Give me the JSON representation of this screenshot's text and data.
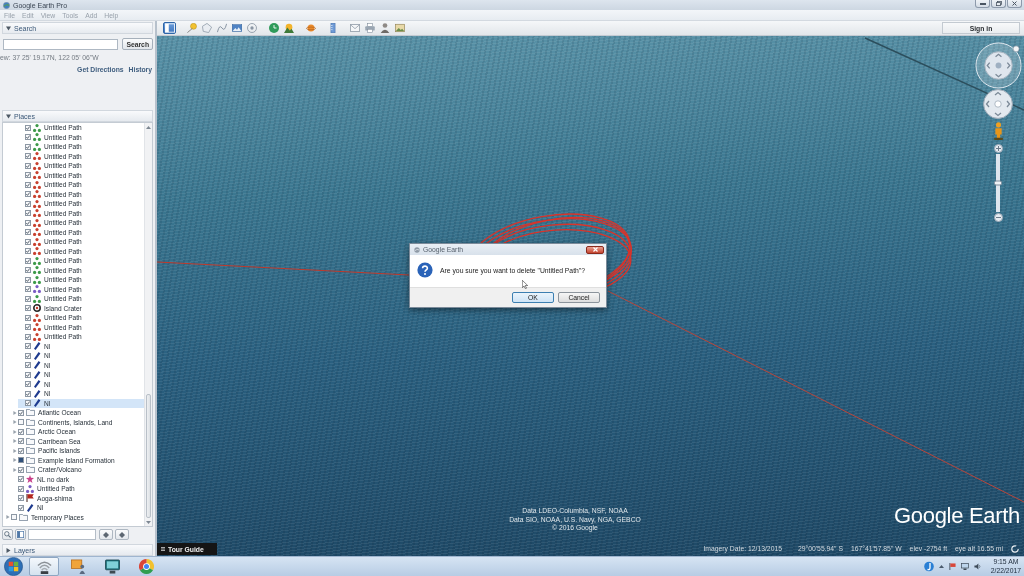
{
  "window": {
    "title": "Google Earth Pro"
  },
  "menu": [
    "File",
    "Edit",
    "View",
    "Tools",
    "Add",
    "Help"
  ],
  "search": {
    "header": "Search",
    "expanded": true,
    "button": "Search",
    "location": "ew: 37 25' 19.17N, 122 05' 06\"W",
    "links": [
      "Get Directions",
      "History"
    ]
  },
  "places": {
    "header": "Places",
    "expanded": true,
    "tree": [
      {
        "children": [
          {
            "children": [
              {
                "label": "Untitled Path",
                "kind": "path",
                "color": "#3c9a48",
                "checked": true,
                "selected": false
              },
              {
                "label": "Untitled Path",
                "kind": "path",
                "color": "#3c9a48",
                "checked": true,
                "selected": false
              },
              {
                "label": "Untitled Path",
                "kind": "path",
                "color": "#3c9a48",
                "checked": true,
                "selected": false
              },
              {
                "label": "Untitled Path",
                "kind": "path",
                "color": "#c8402e",
                "checked": true,
                "selected": false
              },
              {
                "label": "Untitled Path",
                "kind": "path",
                "color": "#c8402e",
                "checked": true,
                "selected": false
              },
              {
                "label": "Untitled Path",
                "kind": "path",
                "color": "#c8402e",
                "checked": true,
                "selected": false
              },
              {
                "label": "Untitled Path",
                "kind": "path",
                "color": "#c8402e",
                "checked": true,
                "selected": false
              },
              {
                "label": "Untitled Path",
                "kind": "path",
                "color": "#c8402e",
                "checked": true,
                "selected": false
              },
              {
                "label": "Untitled Path",
                "kind": "path",
                "color": "#c8402e",
                "checked": true,
                "selected": false
              },
              {
                "label": "Untitled Path",
                "kind": "path",
                "color": "#c8402e",
                "checked": true,
                "selected": false
              },
              {
                "label": "Untitled Path",
                "kind": "path",
                "color": "#c8402e",
                "checked": true,
                "selected": false
              },
              {
                "label": "Untitled Path",
                "kind": "path",
                "color": "#c8402e",
                "checked": true,
                "selected": false
              },
              {
                "label": "Untitled Path",
                "kind": "path",
                "color": "#c8402e",
                "checked": true,
                "selected": false
              },
              {
                "label": "Untitled Path",
                "kind": "path",
                "color": "#c8402e",
                "checked": true,
                "selected": false
              },
              {
                "label": "Untitled Path",
                "kind": "path",
                "color": "#3c9a48",
                "checked": true,
                "selected": false
              },
              {
                "label": "Untitled Path",
                "kind": "path",
                "color": "#3c9a48",
                "checked": true,
                "selected": false
              },
              {
                "label": "Untitled Path",
                "kind": "path",
                "color": "#3c9a48",
                "checked": true,
                "selected": false
              },
              {
                "label": "Untitled Path",
                "kind": "path",
                "color": "#7a5cc4",
                "checked": true,
                "selected": false
              },
              {
                "label": "Untitled Path",
                "kind": "path",
                "color": "#3c9a48",
                "checked": true,
                "selected": false
              },
              {
                "label": "Island Crater",
                "kind": "crater",
                "checked": true,
                "selected": false
              },
              {
                "label": "Untitled Path",
                "kind": "path",
                "color": "#c8402e",
                "checked": true,
                "selected": false
              },
              {
                "label": "Untitled Path",
                "kind": "path",
                "color": "#c8402e",
                "checked": true,
                "selected": false
              },
              {
                "label": "Untitled Path",
                "kind": "path",
                "color": "#c8402e",
                "checked": true,
                "selected": false
              },
              {
                "label": "Nl",
                "kind": "pin",
                "checked": true,
                "selected": false
              },
              {
                "label": "Nl",
                "kind": "pin",
                "checked": true,
                "selected": false
              },
              {
                "label": "Nl",
                "kind": "pin",
                "checked": true,
                "selected": false
              },
              {
                "label": "Nl",
                "kind": "pin",
                "checked": true,
                "selected": false
              },
              {
                "label": "Nl",
                "kind": "pin",
                "checked": true,
                "selected": false
              },
              {
                "label": "Nl",
                "kind": "pin",
                "checked": true,
                "selected": false
              },
              {
                "label": "Nl",
                "kind": "pin",
                "checked": true,
                "selected": true
              }
            ]
          },
          {
            "label": "Atlantic Ocean",
            "kind": "folder",
            "checked": true,
            "partial": false,
            "expanded": false,
            "selected": false
          },
          {
            "label": "Continents, Islands, Land",
            "kind": "folder",
            "checked": false,
            "partial": false,
            "expanded": false,
            "selected": false
          },
          {
            "label": "Arctic Ocean",
            "kind": "folder",
            "checked": true,
            "partial": false,
            "expanded": false,
            "selected": false
          },
          {
            "label": "Carribean Sea",
            "kind": "folder",
            "checked": true,
            "partial": false,
            "expanded": false,
            "selected": false
          },
          {
            "label": "Pacific Islands",
            "kind": "folder",
            "checked": true,
            "partial": false,
            "expanded": false,
            "selected": false
          },
          {
            "label": "Example Island Formation",
            "kind": "folder",
            "checked": true,
            "partial": true,
            "expanded": false,
            "selected": false
          },
          {
            "label": "Crater/Volcano",
            "kind": "folder",
            "checked": true,
            "partial": false,
            "expanded": false,
            "selected": false
          },
          {
            "label": "NL no dark",
            "kind": "star",
            "checked": true,
            "selected": false
          },
          {
            "label": "Untitled Path",
            "kind": "path",
            "color": "#7a5cc4",
            "checked": true,
            "selected": false
          },
          {
            "label": "Aoga-shima",
            "kind": "flag",
            "checked": true,
            "selected": false
          },
          {
            "label": "Nl",
            "kind": "pin",
            "checked": true,
            "selected": false
          }
        ]
      },
      {
        "label": "Temporary Places",
        "kind": "folder",
        "checked": false,
        "partial": false,
        "expanded": false,
        "selected": false
      }
    ]
  },
  "layers": {
    "header": "Layers",
    "expanded": false
  },
  "toolbar": {
    "groups": [
      [
        {
          "kind": "sidebar",
          "selected": true
        }
      ],
      [
        {
          "kind": "placemark",
          "selected": false
        },
        {
          "kind": "polygon",
          "selected": false
        },
        {
          "kind": "path",
          "selected": false
        },
        {
          "kind": "overlay",
          "selected": false
        },
        {
          "kind": "tour",
          "selected": false
        }
      ],
      [
        {
          "kind": "history",
          "selected": false
        },
        {
          "kind": "sun",
          "selected": false
        }
      ],
      [
        {
          "kind": "planets",
          "selected": false
        }
      ],
      [
        {
          "kind": "ruler",
          "selected": false
        }
      ],
      [
        {
          "kind": "email",
          "selected": false
        },
        {
          "kind": "print",
          "selected": false
        },
        {
          "kind": "maps",
          "selected": false
        },
        {
          "kind": "image",
          "selected": false
        }
      ]
    ],
    "sign_in": "Sign in"
  },
  "map": {
    "zoom": {
      "level": 0.5
    },
    "attribution": [
      "Data LDEO-Columbia, NSF, NOAA",
      "Data SIO, NOAA, U.S. Navy, NGA, GEBCO",
      "© 2016 Google"
    ],
    "logo": "Google Earth",
    "tour_guide": "Tour Guide",
    "status": [
      "Imagery Date: 12/13/2015",
      "29°00'55.94\" S",
      "167°41'57.85\" W",
      "elev -2754 ft",
      "eye alt 16.55 mi"
    ]
  },
  "dialog": {
    "title": "Google Earth",
    "message": "Are you sure you want to delete \"Untitled Path\"?",
    "buttons": [
      {
        "label": "OK",
        "default": true
      },
      {
        "label": "Cancel",
        "default": false
      }
    ]
  },
  "taskbar": {
    "apps": [
      {
        "kind": "tool",
        "selected": true
      },
      {
        "kind": "presenter",
        "selected": false
      },
      {
        "kind": "monitor",
        "selected": false
      },
      {
        "kind": "browser",
        "selected": false
      }
    ],
    "time": "9:15 AM",
    "date": "2/22/2017"
  }
}
